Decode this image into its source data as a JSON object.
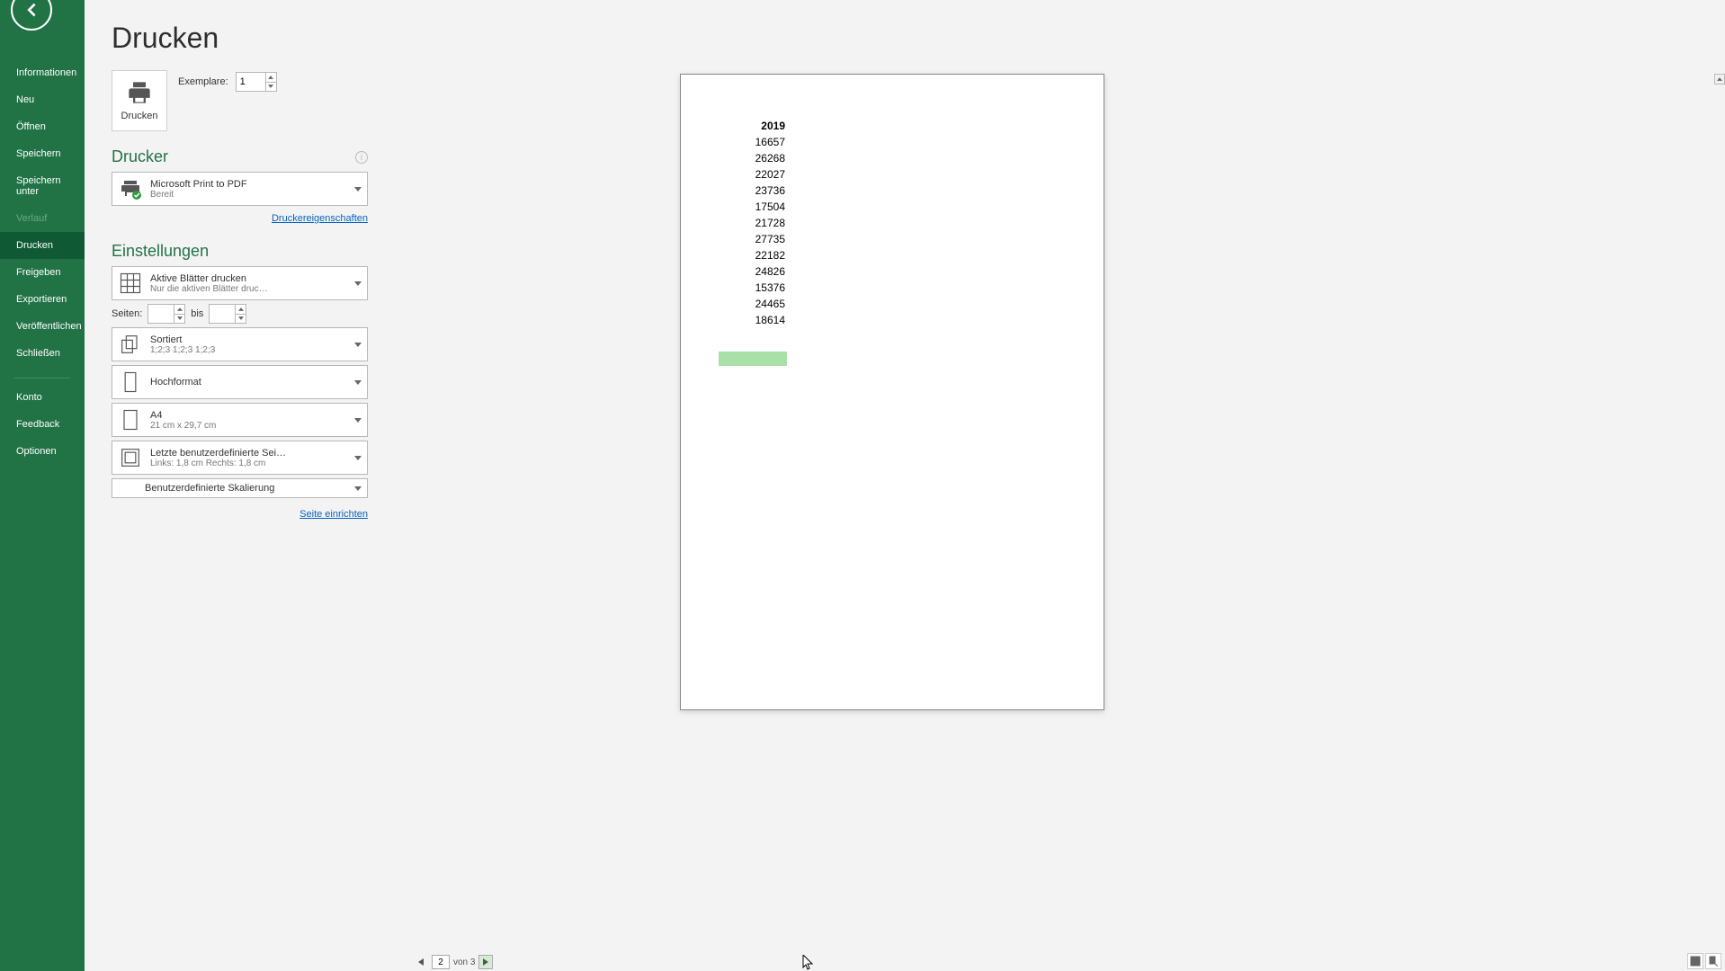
{
  "sidebar": {
    "items": [
      {
        "label": "Informationen"
      },
      {
        "label": "Neu"
      },
      {
        "label": "Öffnen"
      },
      {
        "label": "Speichern"
      },
      {
        "label": "Speichern unter"
      },
      {
        "label": "Verlauf"
      },
      {
        "label": "Drucken"
      },
      {
        "label": "Freigeben"
      },
      {
        "label": "Exportieren"
      },
      {
        "label": "Veröffentlichen"
      },
      {
        "label": "Schließen"
      }
    ],
    "footer": [
      {
        "label": "Konto"
      },
      {
        "label": "Feedback"
      },
      {
        "label": "Optionen"
      }
    ]
  },
  "title": "Drucken",
  "print_button": "Drucken",
  "copies": {
    "label": "Exemplare:",
    "value": "1"
  },
  "printer": {
    "heading": "Drucker",
    "name": "Microsoft Print to PDF",
    "status": "Bereit",
    "props_link": "Druckereigenschaften"
  },
  "settings": {
    "heading": "Einstellungen",
    "what": {
      "line1": "Aktive Blätter drucken",
      "line2": "Nur die aktiven Blätter druc…"
    },
    "pages": {
      "label": "Seiten:",
      "sep": "bis",
      "from": "",
      "to": ""
    },
    "collate": {
      "line1": "Sortiert",
      "line2": "1;2;3    1;2;3    1;2;3"
    },
    "orient": {
      "line1": "Hochformat"
    },
    "paper": {
      "line1": "A4",
      "line2": "21 cm x 29,7 cm"
    },
    "margins": {
      "line1": "Letzte benutzerdefinierte Sei…",
      "line2": "Links: 1,8 cm    Rechts: 1,8 cm"
    },
    "scaling": {
      "line1": "Benutzerdefinierte Skalierung"
    },
    "page_setup_link": "Seite einrichten"
  },
  "preview": {
    "header": "2019",
    "values": [
      "16657",
      "26268",
      "22027",
      "23736",
      "17504",
      "21728",
      "27735",
      "22182",
      "24826",
      "15376",
      "24465",
      "18614"
    ]
  },
  "nav": {
    "current": "2",
    "total_label": "von 3"
  }
}
